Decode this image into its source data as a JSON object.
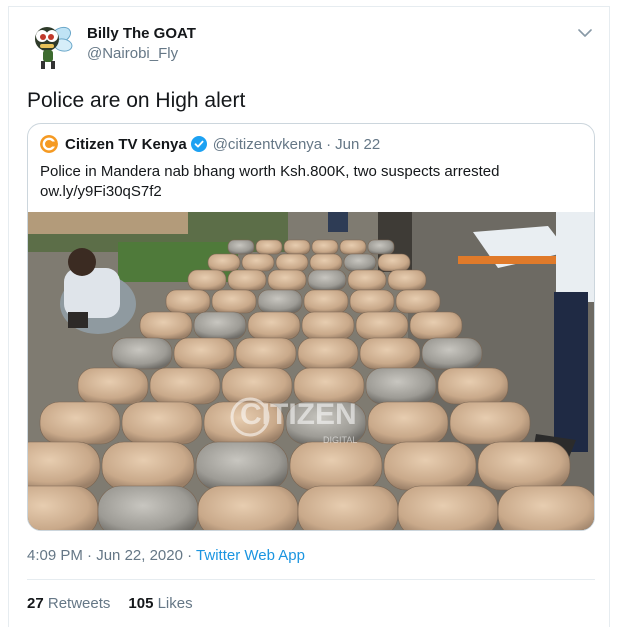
{
  "author": {
    "name": "Billy The GOAT",
    "handle": "@Nairobi_Fly"
  },
  "tweet": {
    "text": "Police are on High alert"
  },
  "quoted": {
    "name": "Citizen TV Kenya",
    "handle": "@citizentvkenya",
    "separator": "·",
    "date": "Jun 22",
    "text_line1": "Police in Mandera nab bhang worth Ksh.800K, two suspects arrested",
    "text_line2": "ow.ly/y9Fi30qS7f2",
    "logo_color": "#f59a23",
    "verified_color": "#1da1f2"
  },
  "media": {
    "watermark": "CITIZEN",
    "watermark_sub": "DIGITAL"
  },
  "meta": {
    "time": "4:09 PM",
    "dot": "·",
    "date": "Jun 22, 2020",
    "dot2": "·",
    "source": "Twitter Web App"
  },
  "stats": {
    "retweets_count": "27",
    "retweets_label": "Retweets",
    "likes_count": "105",
    "likes_label": "Likes"
  },
  "colors": {
    "link": "#1b95e0",
    "secondary_text": "#657786",
    "border": "#e6ecf0"
  }
}
